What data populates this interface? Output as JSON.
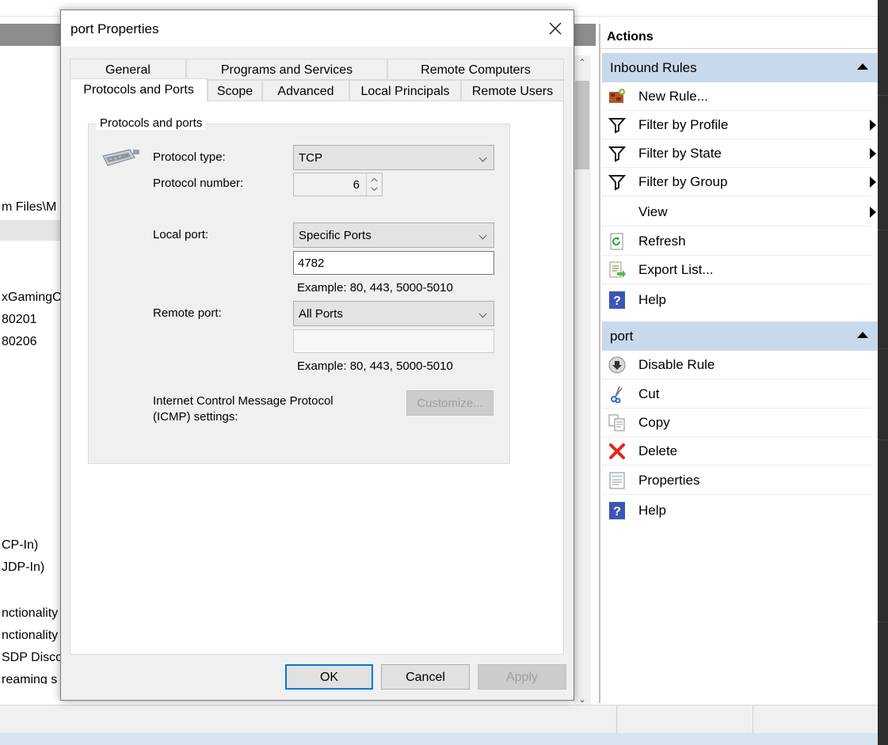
{
  "background": {
    "left_texts": [
      {
        "text": "m Files\\M"
      },
      {
        "text": "xGamingC"
      },
      {
        "text": "80201"
      },
      {
        "text": "80206"
      },
      {
        "text": "CP-In)"
      },
      {
        "text": "JDP-In)"
      },
      {
        "text": "nctionality"
      },
      {
        "text": "nctionality"
      },
      {
        "text": "SDP Discov"
      },
      {
        "text": "reaming s"
      }
    ]
  },
  "actions": {
    "title": "Actions",
    "sections": [
      {
        "header": "Inbound Rules",
        "items": [
          {
            "label": "New Rule...",
            "icon": "new-rule-icon",
            "submenu": false
          },
          {
            "label": "Filter by Profile",
            "icon": "filter-icon",
            "submenu": true
          },
          {
            "label": "Filter by State",
            "icon": "filter-icon",
            "submenu": true
          },
          {
            "label": "Filter by Group",
            "icon": "filter-icon",
            "submenu": true
          },
          {
            "label": "View",
            "icon": "",
            "submenu": true
          },
          {
            "label": "Refresh",
            "icon": "refresh-icon",
            "submenu": false
          },
          {
            "label": "Export List...",
            "icon": "export-icon",
            "submenu": false
          },
          {
            "label": "Help",
            "icon": "help-icon",
            "submenu": false
          }
        ]
      },
      {
        "header": "port",
        "items": [
          {
            "label": "Disable Rule",
            "icon": "disable-icon",
            "submenu": false
          },
          {
            "label": "Cut",
            "icon": "scissors-icon",
            "submenu": false
          },
          {
            "label": "Copy",
            "icon": "copy-icon",
            "submenu": false
          },
          {
            "label": "Delete",
            "icon": "delete-icon",
            "submenu": false
          },
          {
            "label": "Properties",
            "icon": "properties-icon",
            "submenu": false
          },
          {
            "label": "Help",
            "icon": "help-icon",
            "submenu": false
          }
        ]
      }
    ]
  },
  "dialog": {
    "title": "port Properties",
    "tabs_row1": [
      "General",
      "Programs and Services",
      "Remote Computers"
    ],
    "tabs_row2": [
      "Protocols and Ports",
      "Scope",
      "Advanced",
      "Local Principals",
      "Remote Users"
    ],
    "active_tab": "Protocols and Ports",
    "group_title": "Protocols and ports",
    "protocol_type_label": "Protocol type:",
    "protocol_type_value": "TCP",
    "protocol_number_label": "Protocol number:",
    "protocol_number_value": "6",
    "local_port_label": "Local port:",
    "local_port_value": "Specific Ports",
    "local_port_text": "4782",
    "example_text": "Example: 80, 443, 5000-5010",
    "remote_port_label": "Remote port:",
    "remote_port_value": "All Ports",
    "remote_port_text": "",
    "icmp_label_line1": "Internet Control Message Protocol",
    "icmp_label_line2": "(ICMP) settings:",
    "customize_label": "Customize...",
    "ok_label": "OK",
    "cancel_label": "Cancel",
    "apply_label": "Apply"
  },
  "colors": {
    "section_header": "#c9d9ec",
    "accent": "#0078d7"
  }
}
